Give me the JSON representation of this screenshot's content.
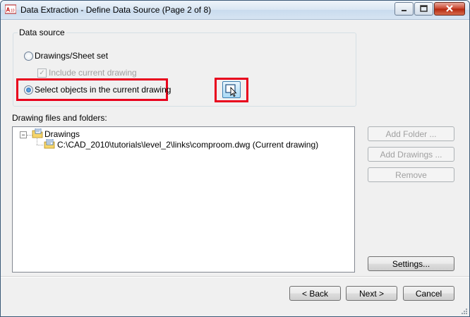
{
  "window": {
    "title": "Data Extraction - Define Data Source (Page 2 of 8)"
  },
  "data_source": {
    "legend": "Data source",
    "option_drawings": "Drawings/Sheet set",
    "option_include_current": "Include current drawing",
    "option_select_objects": "Select objects in the current drawing",
    "selected_option": "Select objects in the current drawing"
  },
  "files": {
    "section_label": "Drawing files and folders:",
    "tree": [
      {
        "label": "Drawings",
        "expanded": true
      },
      {
        "label": "C:\\CAD_2010\\tutorials\\level_2\\links\\comproom.dwg (Current drawing)"
      }
    ]
  },
  "buttons": {
    "add_folder": "Add Folder ...",
    "add_drawings": "Add Drawings ...",
    "remove": "Remove",
    "settings": "Settings...",
    "back": "< Back",
    "next": "Next >",
    "cancel": "Cancel"
  },
  "colors": {
    "highlight_box": "#e8001c",
    "title_gradient": "#d9e6f3",
    "close_button": "#c7412a"
  },
  "icons": {
    "app": "autocad-app-icon",
    "pick": "select-objects-icon",
    "folder": "drawings-folder-icon",
    "file": "dwg-file-icon"
  }
}
